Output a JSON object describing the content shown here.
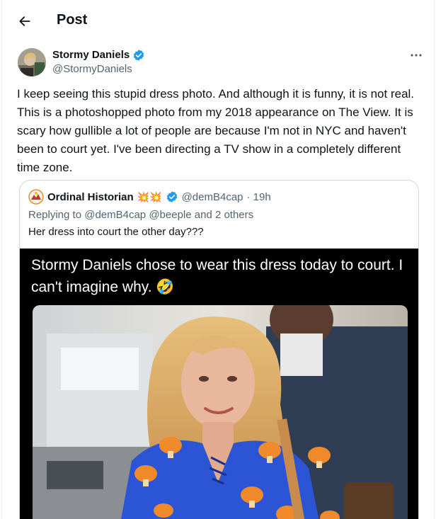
{
  "header": {
    "title": "Post"
  },
  "post": {
    "author_name": "Stormy Daniels",
    "author_handle": "@StormyDaniels",
    "text": "I keep seeing this stupid dress photo. And although it is funny, it is not real.  This is a photoshopped photo from my 2018 appearance on The View. It is scary how gullible a lot of people are because I'm not in NYC and haven't been to court yet. I've been directing a TV show in a completely different time zone."
  },
  "quote": {
    "author_name": "Ordinal Historian",
    "author_emoji": "💥💥",
    "author_handle": "@demB4cap",
    "time": "· 19h",
    "replying_to": "Replying to @demB4cap @beeple and 2 others",
    "text": "Her dress into court the other day???",
    "media_caption": "Stormy Daniels chose to wear this dress today to court. I can't imagine why. 🤣"
  },
  "icons": {
    "back": "arrow-left-icon",
    "verified": "verified-badge-icon",
    "more": "more-icon"
  },
  "colors": {
    "verified": "#1d9bf0",
    "secondary_text": "#536471",
    "border": "#cfd9de"
  }
}
